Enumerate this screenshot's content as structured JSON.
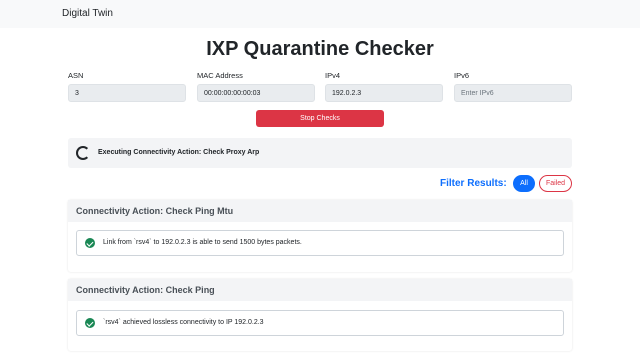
{
  "navbar": {
    "brand": "Digital Twin"
  },
  "page": {
    "title": "IXP Quarantine Checker"
  },
  "form": {
    "fields": [
      {
        "label": "ASN",
        "value": "3",
        "placeholder": ""
      },
      {
        "label": "MAC Address",
        "value": "00:00:00:00:00:03",
        "placeholder": ""
      },
      {
        "label": "IPv4",
        "value": "192.0.2.3",
        "placeholder": ""
      },
      {
        "label": "IPv6",
        "value": "",
        "placeholder": "Enter IPv6"
      }
    ],
    "stop_button": "Stop Checks"
  },
  "status": {
    "text": "Executing Connectivity Action: Check Proxy Arp"
  },
  "filter": {
    "label": "Filter Results:",
    "all": "All",
    "failed": "Failed"
  },
  "results": [
    {
      "title": "Connectivity Action: Check Ping Mtu",
      "message": "Link from `rsv4` to 192.0.2.3 is able to send 1500 bytes packets."
    },
    {
      "title": "Connectivity Action: Check Ping",
      "message": "`rsv4` achieved lossless connectivity to IP 192.0.2.3"
    }
  ],
  "colors": {
    "accent": "#0d6efd",
    "danger": "#dc3545",
    "success": "#198754"
  }
}
